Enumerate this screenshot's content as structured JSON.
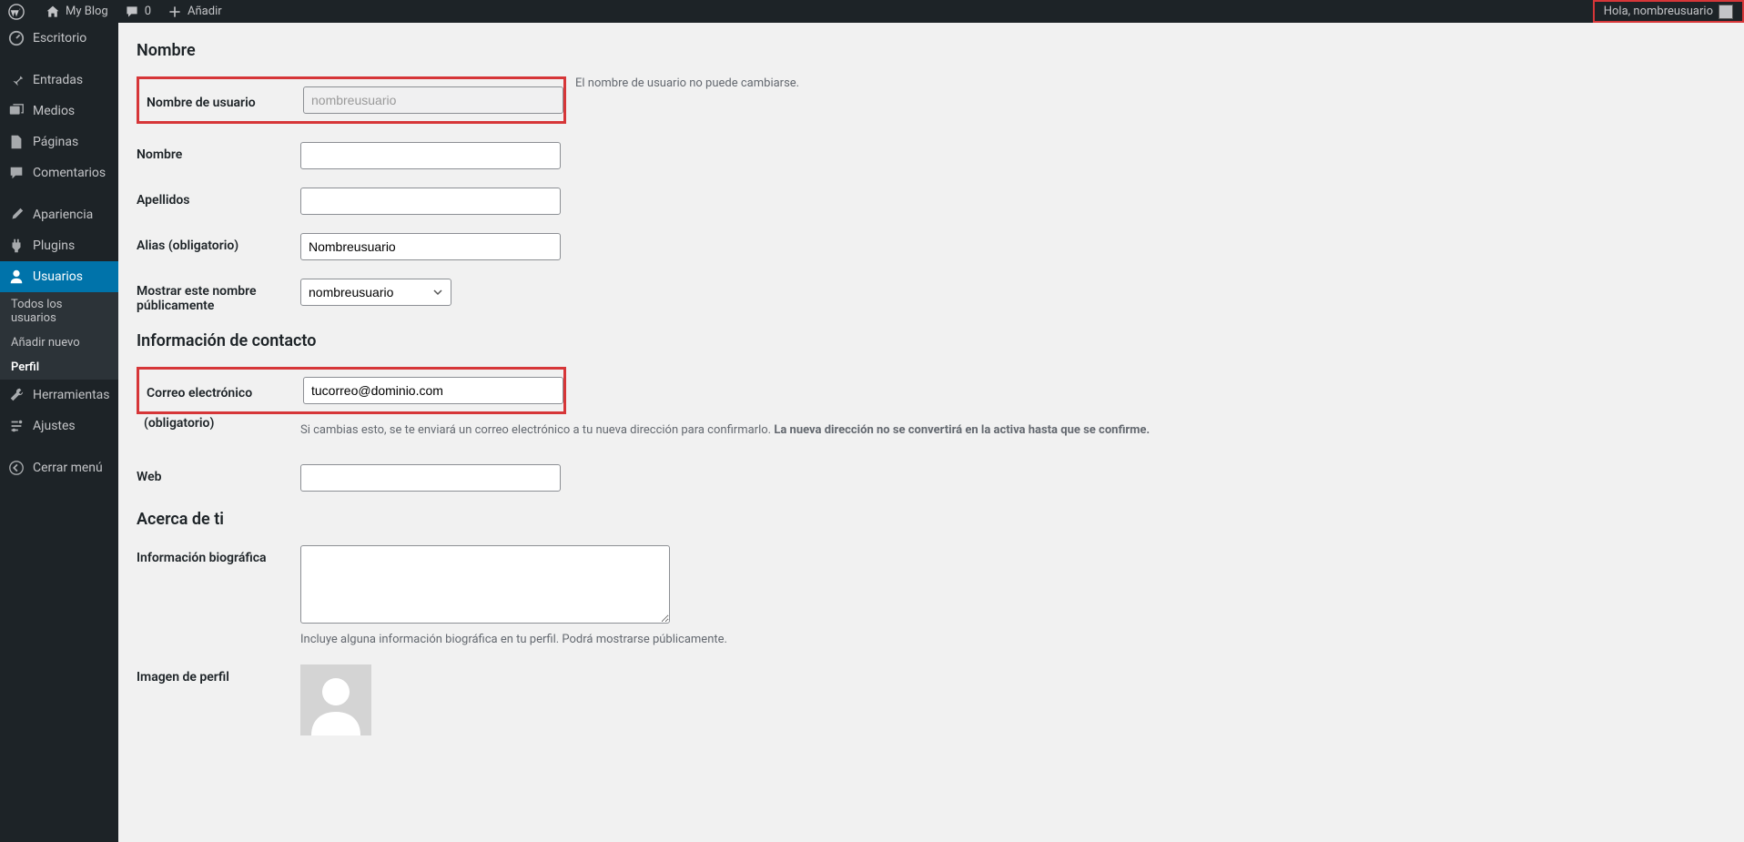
{
  "topbar": {
    "site_name": "My Blog",
    "comment_count": "0",
    "add_label": "Añadir",
    "greeting": "Hola, nombreusuario"
  },
  "sidebar": {
    "items": [
      {
        "label": "Escritorio"
      },
      {
        "label": "Entradas"
      },
      {
        "label": "Medios"
      },
      {
        "label": "Páginas"
      },
      {
        "label": "Comentarios"
      },
      {
        "label": "Apariencia"
      },
      {
        "label": "Plugins"
      },
      {
        "label": "Usuarios"
      },
      {
        "label": "Herramientas"
      },
      {
        "label": "Ajustes"
      },
      {
        "label": "Cerrar menú"
      }
    ],
    "sub": {
      "all_users": "Todos los usuarios",
      "add_new": "Añadir nuevo",
      "profile": "Perfil"
    }
  },
  "sections": {
    "name": "Nombre",
    "contact": "Información de contacto",
    "about": "Acerca de ti"
  },
  "fields": {
    "username_label": "Nombre de usuario",
    "username_value": "nombreusuario",
    "username_desc": "El nombre de usuario no puede cambiarse.",
    "first_name_label": "Nombre",
    "first_name_value": "",
    "last_name_label": "Apellidos",
    "last_name_value": "",
    "nickname_label": "Alias (obligatorio)",
    "nickname_value": "Nombreusuario",
    "display_label": "Mostrar este nombre públicamente",
    "display_value": "nombreusuario",
    "email_label": "Correo electrónico",
    "email_required": "(obligatorio)",
    "email_value": "tucorreo@dominio.com",
    "email_desc_1": "Si cambias esto, se te enviará un correo electrónico a tu nueva dirección para confirmarlo. ",
    "email_desc_2": "La nueva dirección no se convertirá en la activa hasta que se confirme.",
    "web_label": "Web",
    "web_value": "",
    "bio_label": "Información biográfica",
    "bio_value": "",
    "bio_desc": "Incluye alguna información biográfica en tu perfil. Podrá mostrarse públicamente.",
    "avatar_label": "Imagen de perfil"
  }
}
